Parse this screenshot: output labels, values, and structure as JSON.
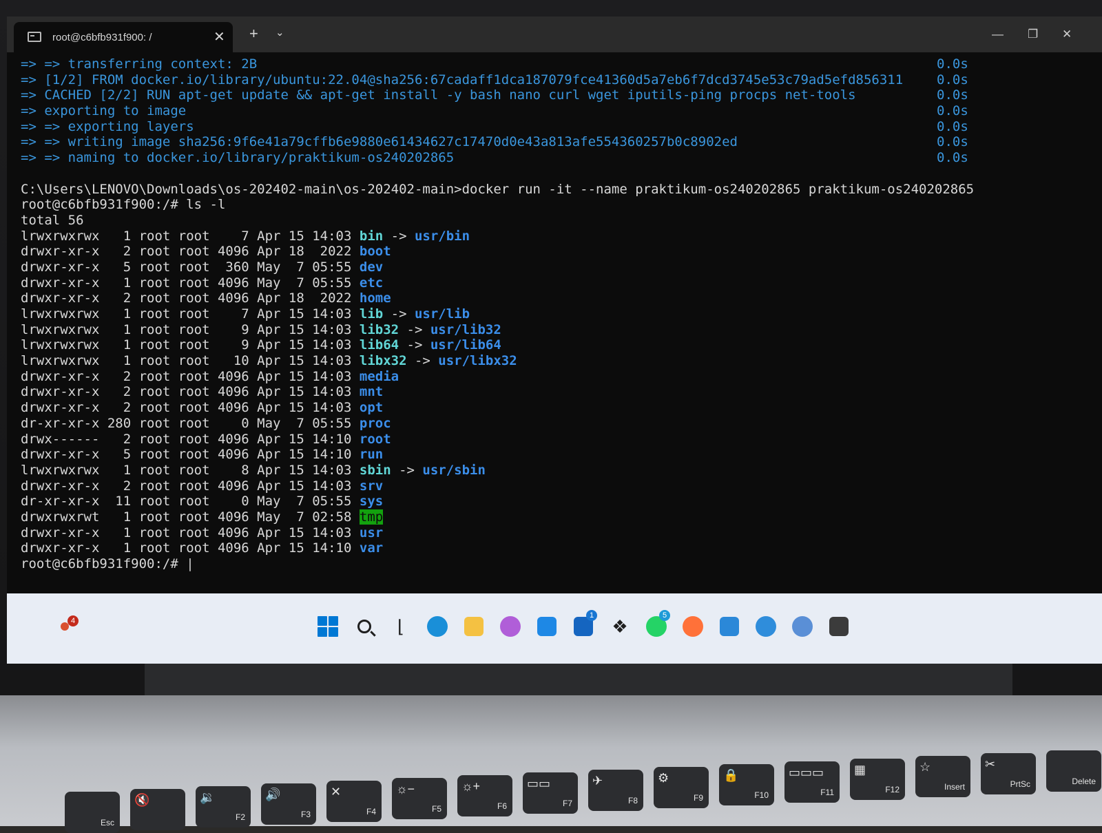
{
  "window": {
    "tab_title": "root@c6bfb931f900: /",
    "tab_close": "✕",
    "new_tab": "+",
    "tab_menu": "⌄",
    "minimize": "—",
    "maximize": "❐",
    "close": "✕"
  },
  "terminal": {
    "build_lines": [
      {
        "text": "=> => transferring context: 2B",
        "time": "0.0s"
      },
      {
        "text": "=> [1/2] FROM docker.io/library/ubuntu:22.04@sha256:67cadaff1dca187079fce41360d5a7eb6f7dcd3745e53c79ad5efd856311",
        "time": "0.0s"
      },
      {
        "text": "=> CACHED [2/2] RUN apt-get update && apt-get install -y bash nano curl wget iputils-ping procps net-tools",
        "time": "0.0s"
      },
      {
        "text": "=> exporting to image",
        "time": "0.0s"
      },
      {
        "text": "=> => exporting layers",
        "time": "0.0s"
      },
      {
        "text": "=> => writing image sha256:9f6e41a79cffb6e9880e61434627c17470d0e43a813afe554360257b0c8902ed",
        "time": "0.0s"
      },
      {
        "text": "=> => naming to docker.io/library/praktikum-os240202865",
        "time": "0.0s"
      }
    ],
    "docker_cmd": "C:\\Users\\LENOVO\\Downloads\\os-202402-main\\os-202402-main>docker run -it --name praktikum-os240202865 praktikum-os240202865",
    "ls_cmd": "root@c6bfb931f900:/# ls -l",
    "total": "total 56",
    "entries": [
      {
        "meta": "lrwxrwxrwx   1 root root    7 Apr 15 14:03 ",
        "name": "bin",
        "link": "usr/bin",
        "type": "link"
      },
      {
        "meta": "drwxr-xr-x   2 root root 4096 Apr 18  2022 ",
        "name": "boot",
        "link": "",
        "type": "dir"
      },
      {
        "meta": "drwxr-xr-x   5 root root  360 May  7 05:55 ",
        "name": "dev",
        "link": "",
        "type": "dir"
      },
      {
        "meta": "drwxr-xr-x   1 root root 4096 May  7 05:55 ",
        "name": "etc",
        "link": "",
        "type": "dir"
      },
      {
        "meta": "drwxr-xr-x   2 root root 4096 Apr 18  2022 ",
        "name": "home",
        "link": "",
        "type": "dir"
      },
      {
        "meta": "lrwxrwxrwx   1 root root    7 Apr 15 14:03 ",
        "name": "lib",
        "link": "usr/lib",
        "type": "link"
      },
      {
        "meta": "lrwxrwxrwx   1 root root    9 Apr 15 14:03 ",
        "name": "lib32",
        "link": "usr/lib32",
        "type": "link"
      },
      {
        "meta": "lrwxrwxrwx   1 root root    9 Apr 15 14:03 ",
        "name": "lib64",
        "link": "usr/lib64",
        "type": "link"
      },
      {
        "meta": "lrwxrwxrwx   1 root root   10 Apr 15 14:03 ",
        "name": "libx32",
        "link": "usr/libx32",
        "type": "link"
      },
      {
        "meta": "drwxr-xr-x   2 root root 4096 Apr 15 14:03 ",
        "name": "media",
        "link": "",
        "type": "dir"
      },
      {
        "meta": "drwxr-xr-x   2 root root 4096 Apr 15 14:03 ",
        "name": "mnt",
        "link": "",
        "type": "dir"
      },
      {
        "meta": "drwxr-xr-x   2 root root 4096 Apr 15 14:03 ",
        "name": "opt",
        "link": "",
        "type": "dir"
      },
      {
        "meta": "dr-xr-xr-x 280 root root    0 May  7 05:55 ",
        "name": "proc",
        "link": "",
        "type": "dir"
      },
      {
        "meta": "drwx------   2 root root 4096 Apr 15 14:10 ",
        "name": "root",
        "link": "",
        "type": "dir"
      },
      {
        "meta": "drwxr-xr-x   5 root root 4096 Apr 15 14:10 ",
        "name": "run",
        "link": "",
        "type": "dir"
      },
      {
        "meta": "lrwxrwxrwx   1 root root    8 Apr 15 14:03 ",
        "name": "sbin",
        "link": "usr/sbin",
        "type": "link"
      },
      {
        "meta": "drwxr-xr-x   2 root root 4096 Apr 15 14:03 ",
        "name": "srv",
        "link": "",
        "type": "dir"
      },
      {
        "meta": "dr-xr-xr-x  11 root root    0 May  7 05:55 ",
        "name": "sys",
        "link": "",
        "type": "dir"
      },
      {
        "meta": "drwxrwxrwt   1 root root 4096 May  7 02:58 ",
        "name": "tmp",
        "link": "",
        "type": "sticky"
      },
      {
        "meta": "drwxr-xr-x   1 root root 4096 Apr 15 14:03 ",
        "name": "usr",
        "link": "",
        "type": "dir"
      },
      {
        "meta": "drwxr-xr-x   1 root root 4096 Apr 15 14:10 ",
        "name": "var",
        "link": "",
        "type": "dir"
      }
    ],
    "arrow": " -> ",
    "prompt": "root@c6bfb931f900:/# ",
    "cursor": "|"
  },
  "taskbar": {
    "left_badge": "4",
    "left_icon": "weather-icon",
    "icons": [
      {
        "name": "start-icon",
        "color": "#0078d4"
      },
      {
        "name": "search-icon",
        "color": "#1f1f1f"
      },
      {
        "name": "task-view-icon",
        "color": "#1f1f1f"
      },
      {
        "name": "edge-icon",
        "color": "#1a8fd8"
      },
      {
        "name": "file-explorer-icon",
        "color": "#f4c142"
      },
      {
        "name": "copilot-icon",
        "color": "#b05ed8"
      },
      {
        "name": "microsoft-store-icon",
        "color": "#1e88e5"
      },
      {
        "name": "lenovo-vantage-icon",
        "color": "#1565c0",
        "badge": "1"
      },
      {
        "name": "dropbox-icon",
        "color": "#1f1f1f"
      },
      {
        "name": "whatsapp-icon",
        "color": "#25d366",
        "badge": "5"
      },
      {
        "name": "firefox-icon",
        "color": "#ff7139"
      },
      {
        "name": "photos-icon",
        "color": "#2b88d8"
      },
      {
        "name": "cloud-app-icon",
        "color": "#2f8ddb"
      },
      {
        "name": "app-circle-icon",
        "color": "#5a8fd6"
      },
      {
        "name": "terminal-icon",
        "color": "#3b3b3b"
      }
    ]
  },
  "keyboard": {
    "keys": [
      {
        "label": "Esc",
        "sym": ""
      },
      {
        "label": "",
        "sym": "🔇"
      },
      {
        "label": "F2",
        "sym": "🔉"
      },
      {
        "label": "F3",
        "sym": "🔊"
      },
      {
        "label": "F4",
        "sym": "✕"
      },
      {
        "label": "F5",
        "sym": "☼−"
      },
      {
        "label": "F6",
        "sym": "☼+"
      },
      {
        "label": "F7",
        "sym": "▭▭"
      },
      {
        "label": "F8",
        "sym": "✈"
      },
      {
        "label": "F9",
        "sym": "⚙"
      },
      {
        "label": "F10",
        "sym": "🔒"
      },
      {
        "label": "F11",
        "sym": "▭▭▭"
      },
      {
        "label": "F12",
        "sym": "▦"
      },
      {
        "label": "Insert",
        "sym": "☆"
      },
      {
        "label": "PrtSc",
        "sym": "✂"
      },
      {
        "label": "Delete",
        "sym": ""
      }
    ]
  }
}
